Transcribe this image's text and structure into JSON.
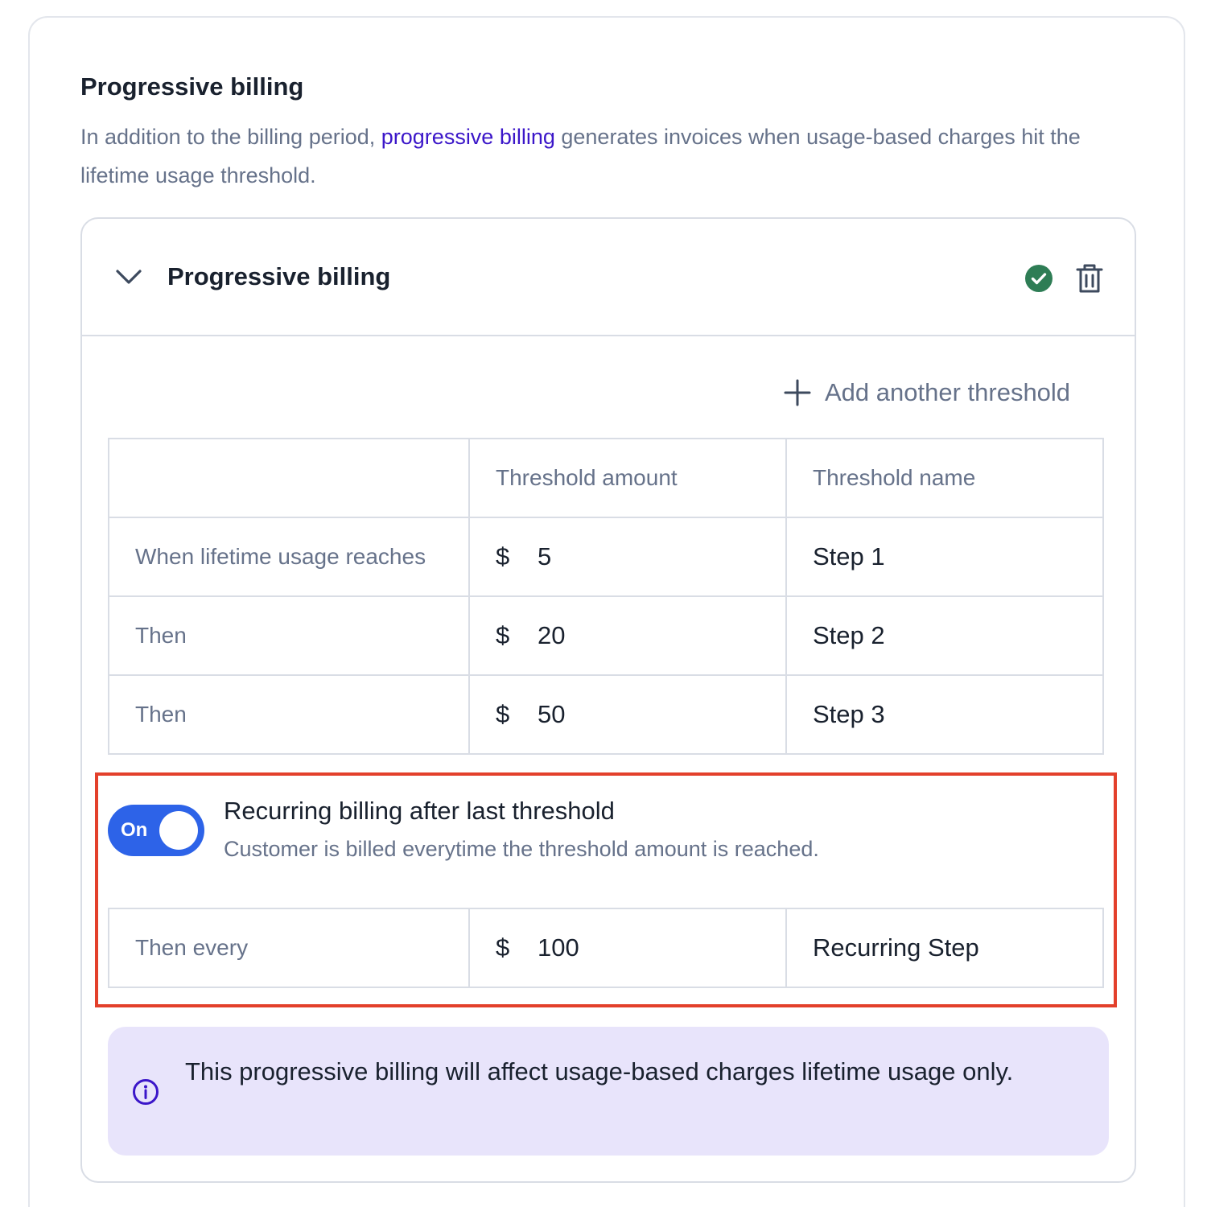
{
  "section": {
    "title": "Progressive billing",
    "desc_before": "In addition to the billing period, ",
    "desc_link": "progressive billing",
    "desc_after": " generates invoices when usage-based charges hit the lifetime usage threshold."
  },
  "card": {
    "title": "Progressive billing",
    "status_icon": "check-circle-icon",
    "status_color": "#2e7d55",
    "delete_icon": "trash-icon",
    "add_threshold_label": "Add another threshold"
  },
  "table": {
    "headers": [
      "",
      "Threshold amount",
      "Threshold name"
    ],
    "currency": "$",
    "rows": [
      {
        "label": "When lifetime usage reaches",
        "amount": "5",
        "name": "Step 1"
      },
      {
        "label": "Then",
        "amount": "20",
        "name": "Step 2"
      },
      {
        "label": "Then",
        "amount": "50",
        "name": "Step 3"
      }
    ]
  },
  "recurring": {
    "toggle_label": "On",
    "toggle_on": true,
    "toggle_color": "#2d63e8",
    "title": "Recurring billing after last threshold",
    "subtitle": "Customer is billed everytime the threshold amount is reached.",
    "row": {
      "label": "Then every",
      "amount": "100",
      "name": "Recurring Step"
    }
  },
  "info": {
    "icon": "info-icon",
    "text": "This progressive billing will affect usage-based charges lifetime usage only."
  }
}
